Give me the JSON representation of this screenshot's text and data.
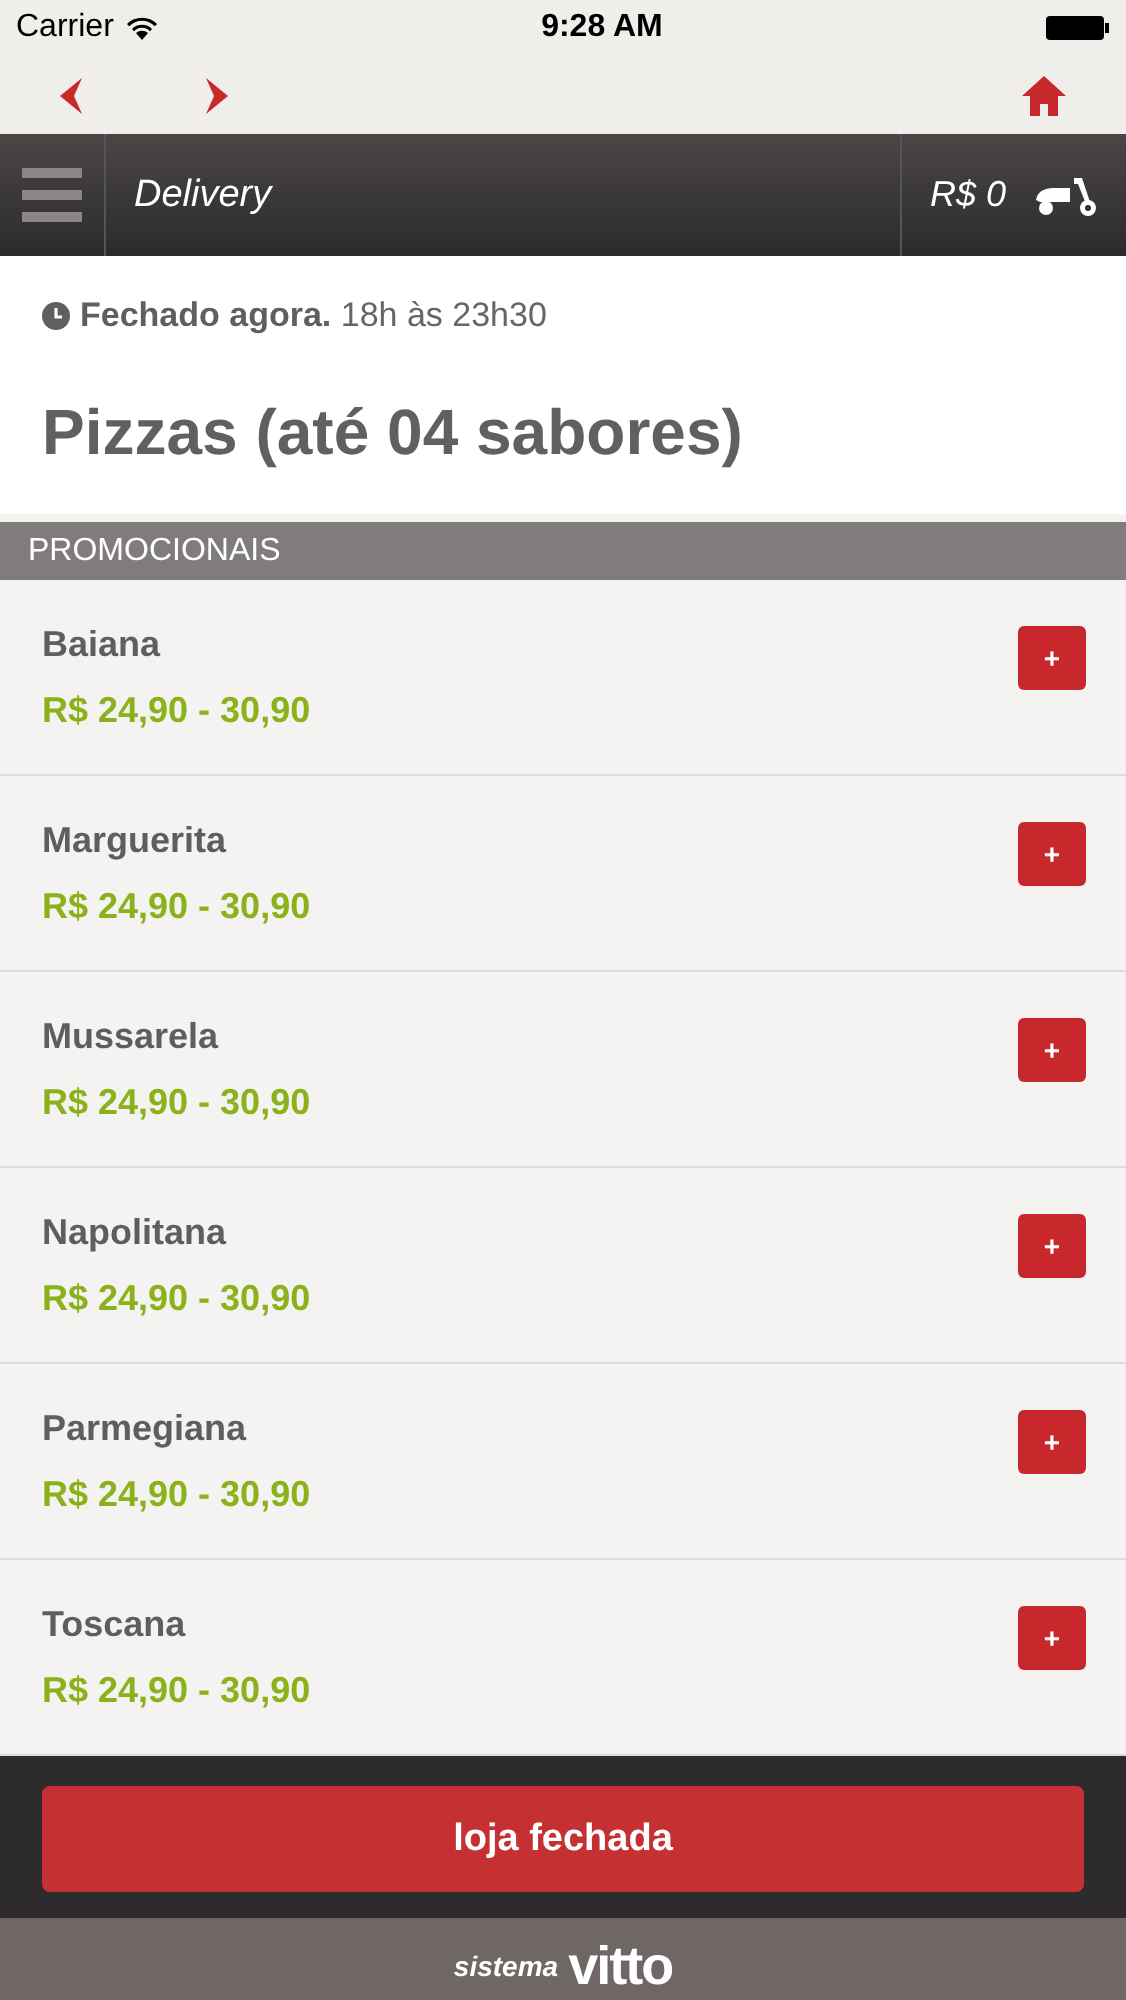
{
  "status_bar": {
    "carrier": "Carrier",
    "time": "9:28 AM"
  },
  "header": {
    "title": "Delivery",
    "cart_total": "R$ 0"
  },
  "store_status": {
    "state": "Fechado agora.",
    "hours": "18h às 23h30"
  },
  "category": {
    "title": "Pizzas (até 04 sabores)"
  },
  "section": {
    "title": "PROMOCIONAIS"
  },
  "items": [
    {
      "name": "Baiana",
      "price": "R$ 24,90 - 30,90",
      "add": "+"
    },
    {
      "name": "Marguerita",
      "price": "R$ 24,90 - 30,90",
      "add": "+"
    },
    {
      "name": "Mussarela",
      "price": "R$ 24,90 - 30,90",
      "add": "+"
    },
    {
      "name": "Napolitana",
      "price": "R$ 24,90 - 30,90",
      "add": "+"
    },
    {
      "name": "Parmegiana",
      "price": "R$ 24,90 - 30,90",
      "add": "+"
    },
    {
      "name": "Toscana",
      "price": "R$ 24,90 - 30,90",
      "add": "+"
    }
  ],
  "overlay": {
    "button": "loja fechada"
  },
  "footer": {
    "brand_small": "sistema",
    "brand": "vitto"
  }
}
